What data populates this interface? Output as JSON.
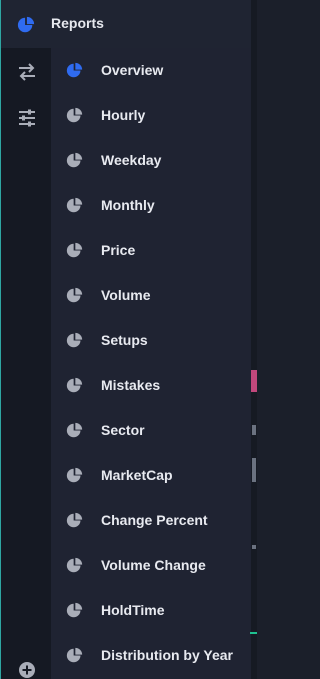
{
  "header": {
    "label": "Reports",
    "icon": "pie-chart-icon"
  },
  "rail": {
    "icons": [
      "swap-arrows-icon",
      "sliders-icon",
      "add-circle-icon"
    ]
  },
  "menu": {
    "items": [
      {
        "label": "Overview",
        "icon": "pie-chart-icon",
        "active": true
      },
      {
        "label": "Hourly",
        "icon": "pie-chart-icon"
      },
      {
        "label": "Weekday",
        "icon": "pie-chart-icon"
      },
      {
        "label": "Monthly",
        "icon": "pie-chart-icon"
      },
      {
        "label": "Price",
        "icon": "pie-chart-icon"
      },
      {
        "label": "Volume",
        "icon": "pie-chart-icon"
      },
      {
        "label": "Setups",
        "icon": "pie-chart-icon"
      },
      {
        "label": "Mistakes",
        "icon": "pie-chart-icon"
      },
      {
        "label": "Sector",
        "icon": "pie-chart-icon"
      },
      {
        "label": "MarketCap",
        "icon": "pie-chart-icon"
      },
      {
        "label": "Change Percent",
        "icon": "pie-chart-icon"
      },
      {
        "label": "Volume Change",
        "icon": "pie-chart-icon"
      },
      {
        "label": "HoldTime",
        "icon": "pie-chart-icon"
      },
      {
        "label": "Distribution by Year",
        "icon": "pie-chart-icon"
      }
    ]
  },
  "colors": {
    "accent": "#2f6bf0",
    "icon_muted": "#a9adb8",
    "text": "#e8eaf0",
    "edge": "#2ea6a2",
    "pink": "#c2487c",
    "green": "#1fc090"
  }
}
